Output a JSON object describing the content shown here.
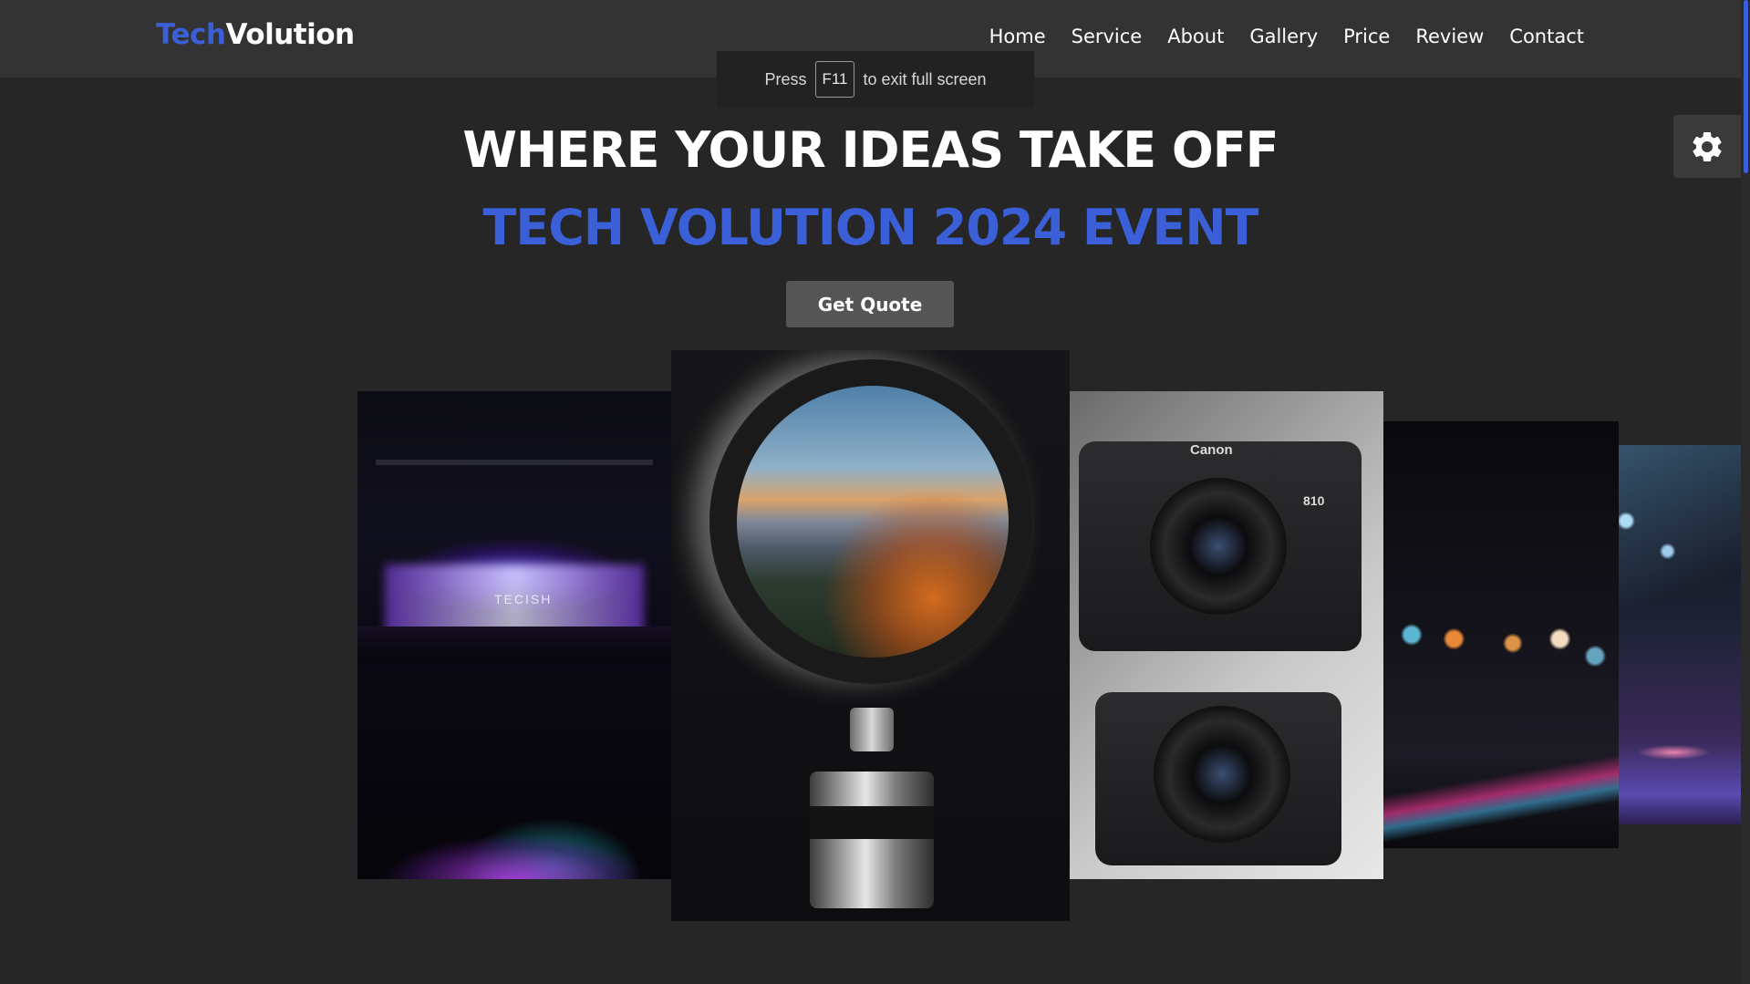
{
  "brand": {
    "accent": "Tech",
    "rest": "Volution",
    "accent_color": "#3a5fd6"
  },
  "nav": {
    "items": [
      {
        "label": "Home"
      },
      {
        "label": "Service"
      },
      {
        "label": "About"
      },
      {
        "label": "Gallery"
      },
      {
        "label": "Price"
      },
      {
        "label": "Review"
      },
      {
        "label": "Contact"
      }
    ]
  },
  "fullscreen_toast": {
    "prefix": "Press",
    "key": "F11",
    "suffix": "to exit full screen"
  },
  "settings": {
    "icon": "gear-icon"
  },
  "hero": {
    "title": "WHERE YOUR IDEAS TAKE OFF",
    "subtitle": "TECH VOLUTION 2024 EVENT",
    "button_label": "Get Quote"
  },
  "gallery": {
    "concert_caption": "TECISH",
    "camera_brand": "Canon",
    "camera_model": "810"
  },
  "colors": {
    "background": "#262626",
    "navbar": "#333333",
    "accent": "#3a5fd6",
    "button": "#555555"
  }
}
